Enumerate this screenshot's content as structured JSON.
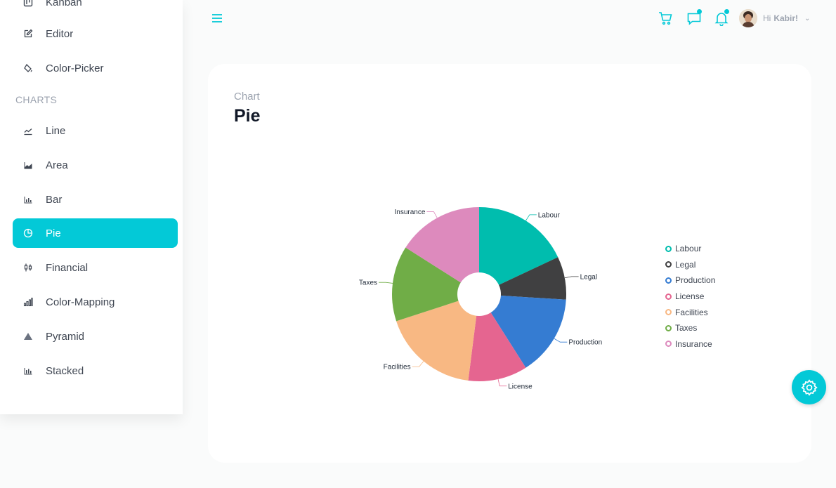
{
  "sidebar": {
    "items_top": [
      {
        "label": "Kanban",
        "icon": "kanban-icon"
      },
      {
        "label": "Editor",
        "icon": "edit-icon"
      },
      {
        "label": "Color-Picker",
        "icon": "paint-bucket-icon"
      }
    ],
    "section_title": "CHARTS",
    "chart_items": [
      {
        "label": "Line",
        "icon": "line-chart-icon"
      },
      {
        "label": "Area",
        "icon": "area-chart-icon"
      },
      {
        "label": "Bar",
        "icon": "bar-chart-icon"
      },
      {
        "label": "Pie",
        "icon": "pie-chart-icon",
        "active": true
      },
      {
        "label": "Financial",
        "icon": "stock-icon"
      },
      {
        "label": "Color-Mapping",
        "icon": "color-mapping-icon"
      },
      {
        "label": "Pyramid",
        "icon": "pyramid-icon"
      },
      {
        "label": "Stacked",
        "icon": "stacked-chart-icon"
      }
    ]
  },
  "header": {
    "menu_icon": "hamburger-menu-icon",
    "icons": [
      "cart-icon",
      "chat-icon",
      "bell-icon"
    ],
    "profile": {
      "greeting": "Hi",
      "name": "Kabir!"
    }
  },
  "card": {
    "subtitle": "Chart",
    "title": "Pie"
  },
  "colors": {
    "accent": "#03c9d7"
  },
  "chart_data": {
    "type": "pie",
    "style": "donut",
    "categories": [
      "Labour",
      "Legal",
      "Production",
      "License",
      "Facilities",
      "Taxes",
      "Insurance"
    ],
    "values": [
      18,
      8,
      15,
      11,
      18,
      14,
      16
    ],
    "colors": [
      "#00bdae",
      "#404041",
      "#357cd2",
      "#e56590",
      "#f8b883",
      "#70ad47",
      "#dd8abd"
    ],
    "legend": "right"
  }
}
